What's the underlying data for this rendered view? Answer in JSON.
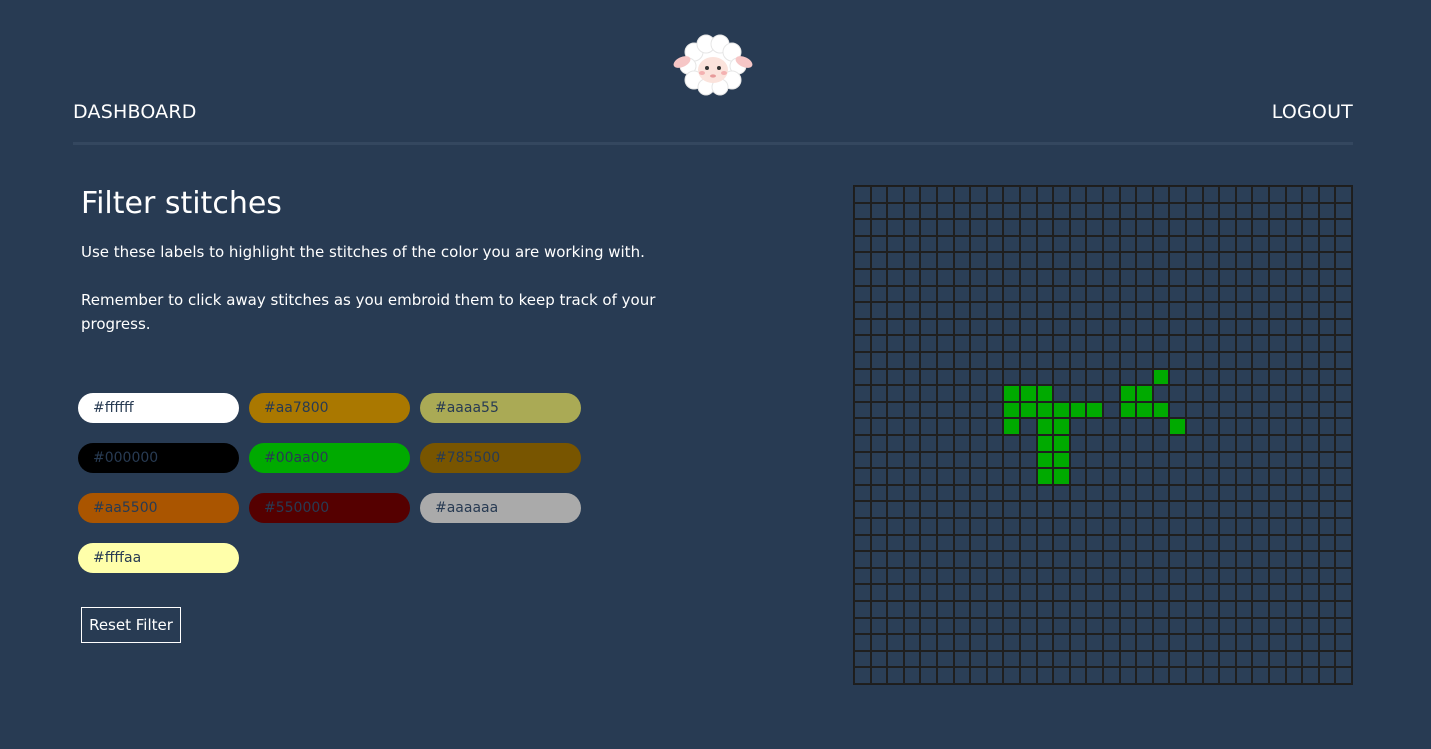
{
  "nav": {
    "dashboard_label": "DASHBOARD",
    "logout_label": "LOGOUT"
  },
  "main": {
    "title": "Filter stitches",
    "description": "Use these labels to highlight the stitches of the color you are working with.",
    "reminder": "Remember to click away stitches as you embroid them to keep track of your progress.",
    "reset_label": "Reset Filter"
  },
  "color_chips": [
    {
      "label": "#ffffff",
      "bg": "#ffffff",
      "text": "#283b53"
    },
    {
      "label": "#aa7800",
      "bg": "#aa7800",
      "text": "#283b53"
    },
    {
      "label": "#aaaa55",
      "bg": "#aaaa55",
      "text": "#283b53"
    },
    {
      "label": "#000000",
      "bg": "#000000",
      "text": "#283b53"
    },
    {
      "label": "#00aa00",
      "bg": "#00aa00",
      "text": "#283b53"
    },
    {
      "label": "#785500",
      "bg": "#785500",
      "text": "#283b53"
    },
    {
      "label": "#aa5500",
      "bg": "#aa5500",
      "text": "#283b53"
    },
    {
      "label": "#550000",
      "bg": "#550000",
      "text": "#283b53"
    },
    {
      "label": "#aaaaaa",
      "bg": "#aaaaaa",
      "text": "#283b53"
    },
    {
      "label": "#ffffaa",
      "bg": "#ffffaa",
      "text": "#283b53"
    }
  ],
  "pattern": {
    "columns": 30,
    "rows": 30,
    "empty_color": "#2b3f57",
    "stitch_color": "#00aa00",
    "highlighted_cells": [
      [
        11,
        18
      ],
      [
        12,
        9
      ],
      [
        12,
        10
      ],
      [
        12,
        11
      ],
      [
        12,
        16
      ],
      [
        12,
        17
      ],
      [
        13,
        9
      ],
      [
        13,
        10
      ],
      [
        13,
        11
      ],
      [
        13,
        12
      ],
      [
        13,
        13
      ],
      [
        13,
        14
      ],
      [
        13,
        16
      ],
      [
        13,
        17
      ],
      [
        13,
        18
      ],
      [
        14,
        9
      ],
      [
        14,
        11
      ],
      [
        14,
        12
      ],
      [
        14,
        19
      ],
      [
        15,
        11
      ],
      [
        15,
        12
      ],
      [
        16,
        11
      ],
      [
        16,
        12
      ],
      [
        17,
        11
      ],
      [
        17,
        12
      ]
    ]
  },
  "colors": {
    "background": "#283b53",
    "divider": "#34475f",
    "text": "#ffffff"
  },
  "icons": {
    "logo": "sheep-logo"
  }
}
